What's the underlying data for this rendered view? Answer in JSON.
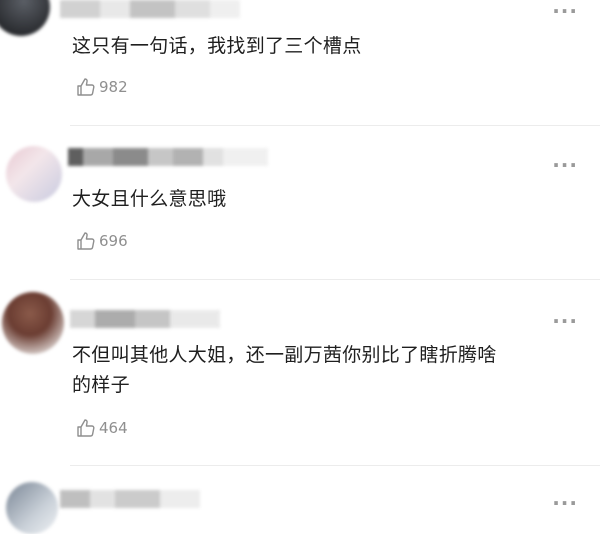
{
  "comments": [
    {
      "text": "这只有一句话，我找到了三个槽点",
      "likes": "982"
    },
    {
      "text": "大女且什么意思哦",
      "likes": "696"
    },
    {
      "text_line1": "不但叫其他人大姐，还一副万茜你别比了瞎折腾啥",
      "text_line2": "的样子",
      "likes": "464"
    }
  ],
  "icons": {
    "like": "thumbs-up-icon",
    "more": "more-options-icon"
  }
}
